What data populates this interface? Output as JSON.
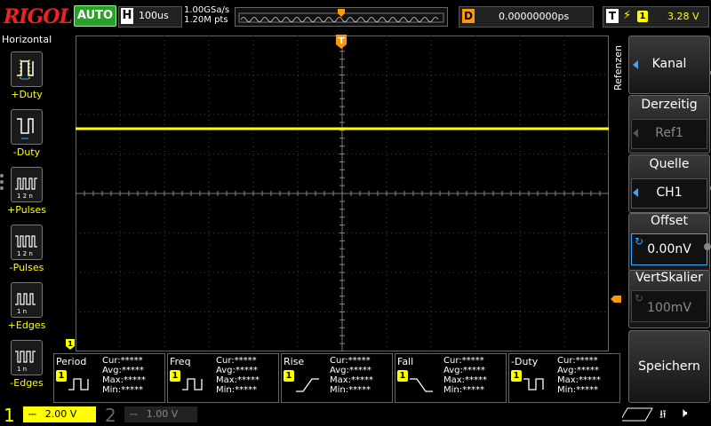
{
  "brand": "RIGOL",
  "top": {
    "run_mode": "AUTO",
    "timebase_label": "H",
    "timebase_value": "100us",
    "sample_rate": "1.00GSa/s",
    "memory_depth": "1.20M pts",
    "delay_label": "D",
    "delay_value": "0.00000000ps",
    "trigger_label": "T",
    "trigger_channel": "1",
    "trigger_level": "3.28 V"
  },
  "left_panel": {
    "title": "Horizontal",
    "items": [
      {
        "label": "+Duty",
        "icon": "positive-duty-icon"
      },
      {
        "label": "-Duty",
        "icon": "negative-duty-icon"
      },
      {
        "label": "+Pulses",
        "icon": "positive-pulses-icon"
      },
      {
        "label": "-Pulses",
        "icon": "negative-pulses-icon"
      },
      {
        "label": "+Edges",
        "icon": "positive-edges-icon"
      },
      {
        "label": "-Edges",
        "icon": "negative-edges-icon"
      }
    ]
  },
  "right_menu": {
    "side_label": "Refenzen",
    "kanal": "Kanal",
    "derzeitig_title": "Derzeitig",
    "derzeitig_value": "Ref1",
    "quelle_title": "Quelle",
    "quelle_value": "CH1",
    "offset_title": "Offset",
    "offset_value": "0.00nV",
    "vert_title": "VertSkalier",
    "vert_value": "100mV",
    "speichern": "Speichern"
  },
  "markers": {
    "trigger_pos": "T",
    "ch1_ground": "1"
  },
  "measurements": [
    {
      "name": "Period",
      "channel": "1",
      "cur": "Cur:*****",
      "avg": "Avg:*****",
      "max": "Max:*****",
      "min": "Min:*****"
    },
    {
      "name": "Freq",
      "channel": "1",
      "cur": "Cur:*****",
      "avg": "Avg:*****",
      "max": "Max:*****",
      "min": "Min:*****"
    },
    {
      "name": "Rise",
      "channel": "1",
      "cur": "Cur:*****",
      "avg": "Avg:*****",
      "max": "Max:*****",
      "min": "Min:*****"
    },
    {
      "name": "Fall",
      "channel": "1",
      "cur": "Cur:*****",
      "avg": "Avg:*****",
      "max": "Max:*****",
      "min": "Min:*****"
    },
    {
      "name": "-Duty",
      "channel": "1",
      "cur": "Cur:*****",
      "avg": "Avg:*****",
      "max": "Max:*****",
      "min": "Min:*****"
    }
  ],
  "bottom": {
    "ch1_num": "1",
    "ch1_scale": "2.00 V",
    "ch2_num": "2",
    "ch2_scale": "1.00 V"
  },
  "colors": {
    "ch1": "#ffff00",
    "trigger": "#ff9900",
    "accent": "#33aaff",
    "auto": "#2aa02a"
  }
}
